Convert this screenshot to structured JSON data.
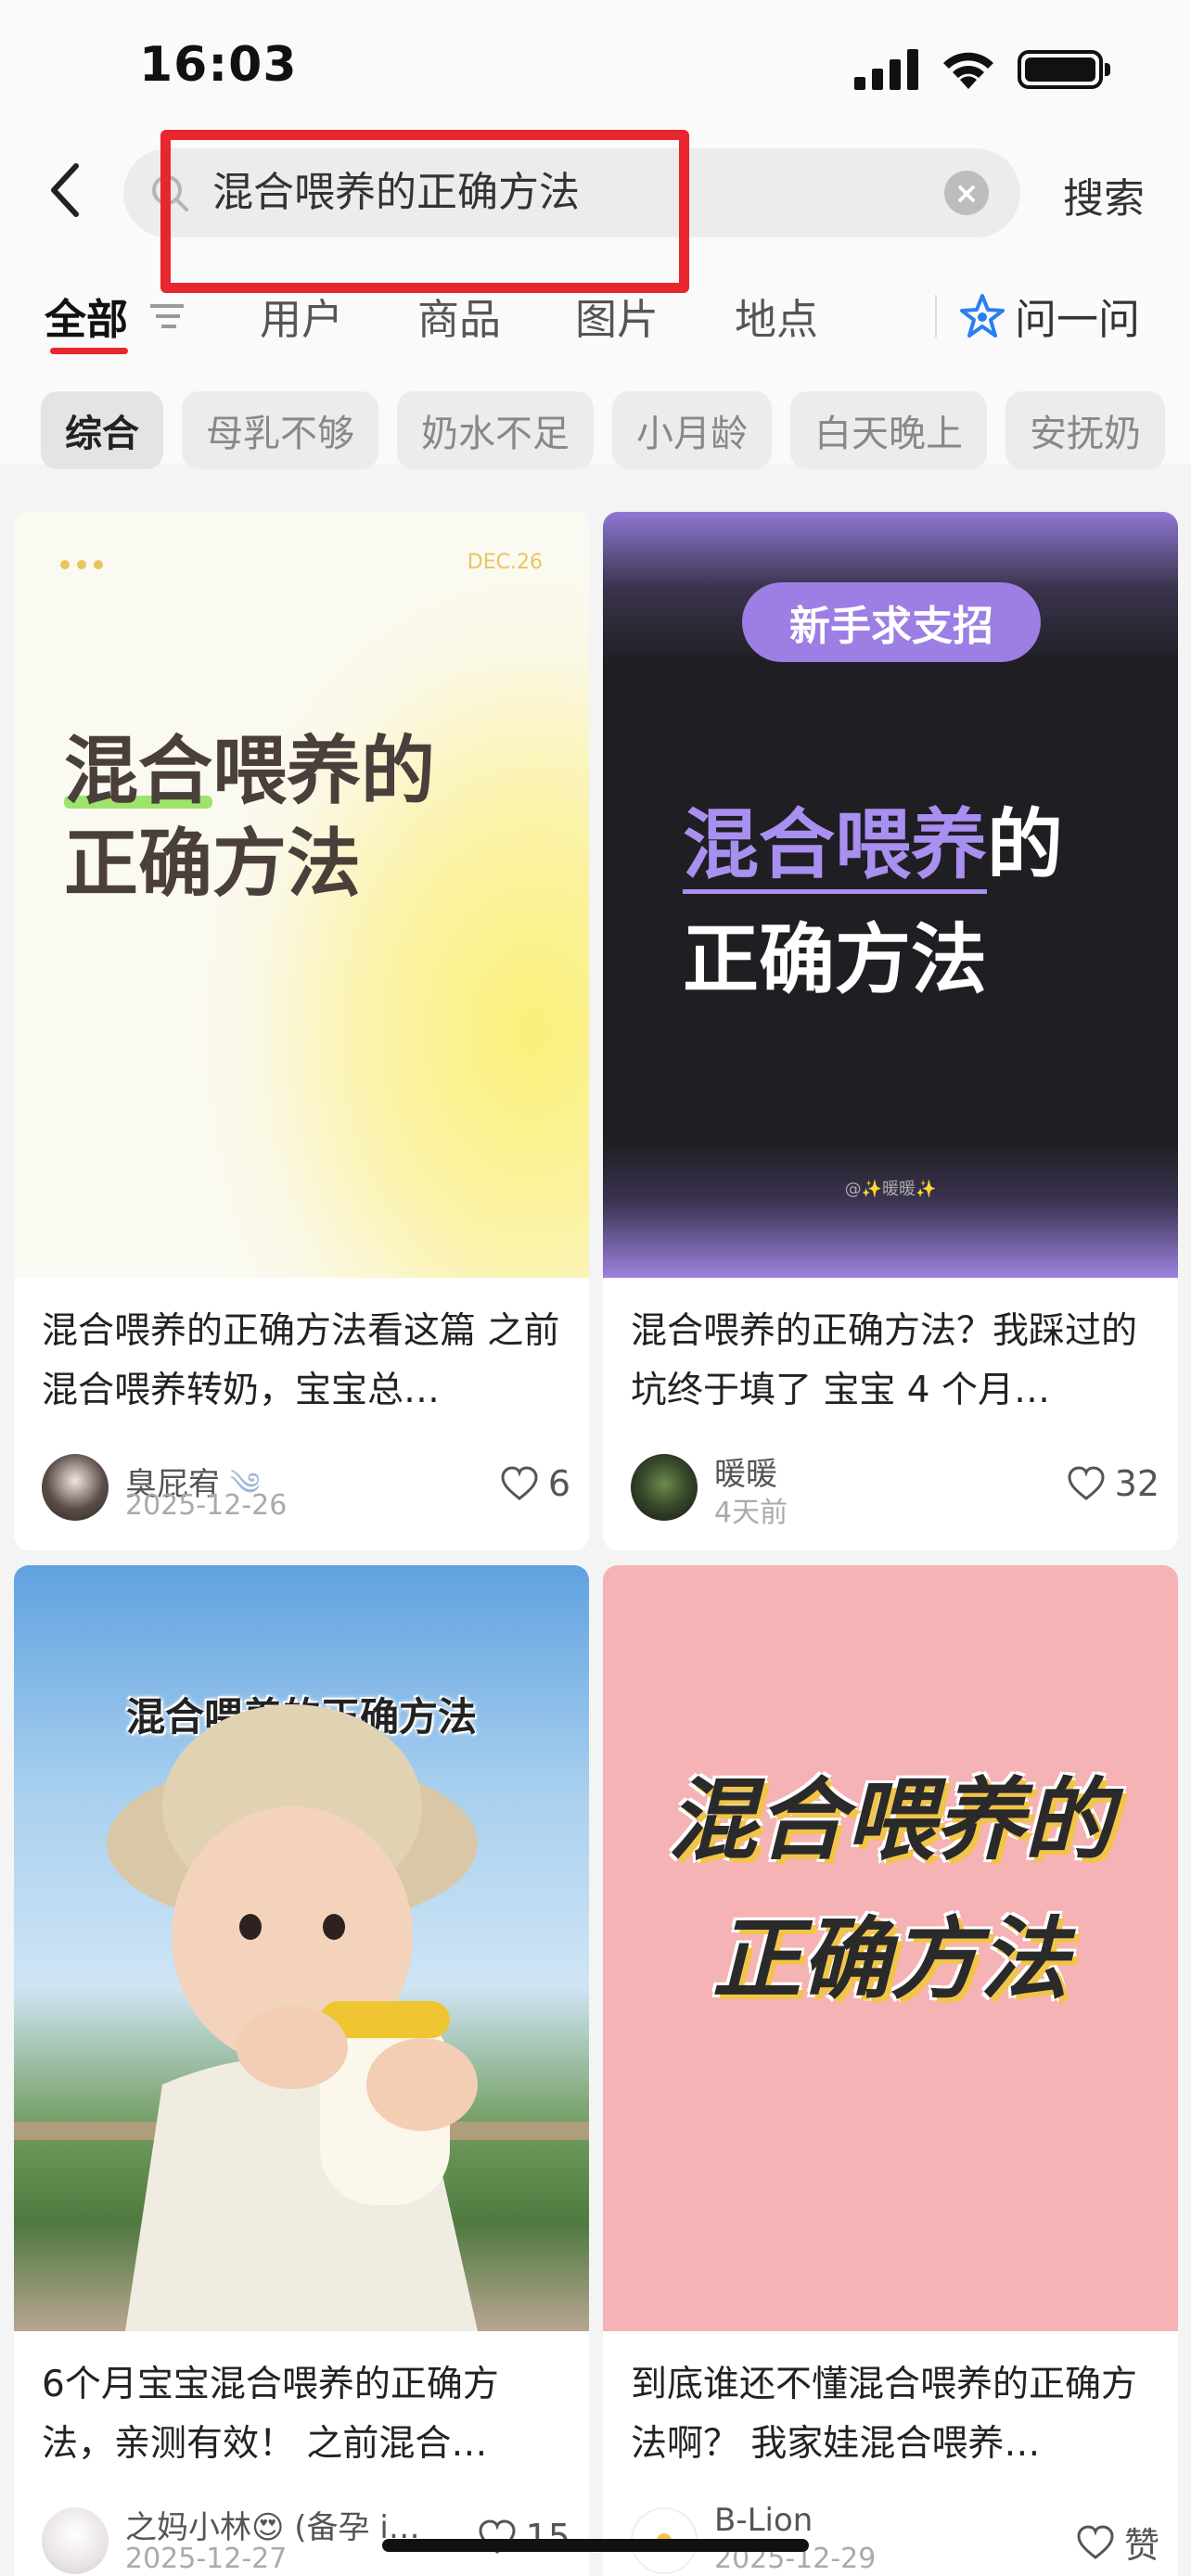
{
  "status_bar": {
    "time": "16:03"
  },
  "search": {
    "query": "混合喂养的正确方法",
    "submit_label": "搜索"
  },
  "tabs": [
    {
      "label": "全部",
      "active": true
    },
    {
      "label": "用户"
    },
    {
      "label": "商品"
    },
    {
      "label": "图片"
    },
    {
      "label": "地点"
    }
  ],
  "ask_label": "问一问",
  "chips": [
    "综合",
    "母乳不够",
    "奶水不足",
    "小月龄",
    "白天晚上",
    "安抚奶"
  ],
  "cards": [
    {
      "cover_tag": "DEC.26",
      "cover_line1_highlight": "混合",
      "cover_line1_rest": "喂养的",
      "cover_line2": "正确方法",
      "title": "混合喂养的正确方法看这篇 之前混合喂养转奶，宝宝总…",
      "author": "臭屁宥",
      "date": "2025-12-26",
      "likes": "6"
    },
    {
      "cover_badge": "新手求支招",
      "cover_line1_highlight": "混合喂养",
      "cover_line1_rest": "的",
      "cover_line2": "正确方法",
      "cover_watermark": "@✨暖暖✨",
      "title": "混合喂养的正确方法？我踩过的坑终于填了 宝宝 4 个月…",
      "author": "暖暖",
      "date": "4天前",
      "likes": "32"
    },
    {
      "cover_caption": "混合喂养的正确方法",
      "title": "6个月宝宝混合喂养的正确方法，亲测有效！ 之前混合…",
      "author": "之妈小林😍 (备孕 i…",
      "date": "2025-12-27",
      "likes": "15"
    },
    {
      "cover_line1": "混合喂养的",
      "cover_line2": "正确方法",
      "title": "到底谁还不懂混合喂养的正确方法啊？ 我家娃混合喂养…",
      "author": "B-Lion",
      "date": "2025-12-29",
      "likes": "赞"
    }
  ]
}
